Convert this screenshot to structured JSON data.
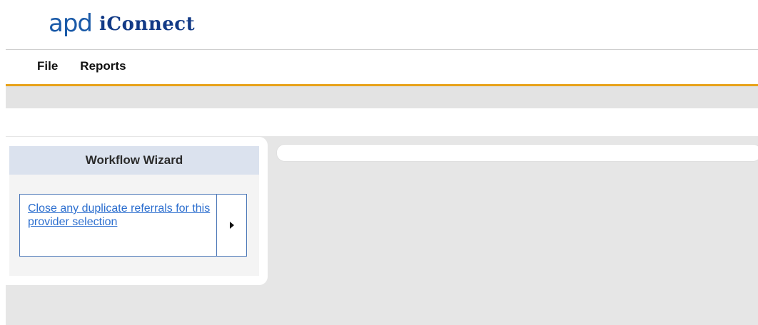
{
  "header": {
    "logo_apd": "apd",
    "logo_iconnect": "iConnect"
  },
  "menu": {
    "items": [
      {
        "label": "File"
      },
      {
        "label": "Reports"
      }
    ]
  },
  "colors": {
    "menu_underline": "#e8a21a",
    "wizard_title_bg": "#dbe2ee",
    "link": "#2d6fcf",
    "task_border": "#4e79b8",
    "logo_blue": "#1a5aa8",
    "logo_green": "#5aa830",
    "logo_dark_blue": "#123a86"
  },
  "workflow_wizard": {
    "title": "Workflow Wizard",
    "tasks": [
      {
        "label": "Close any duplicate referrals for this provider selection",
        "arrow_icon": "triangle-right-icon"
      }
    ]
  }
}
